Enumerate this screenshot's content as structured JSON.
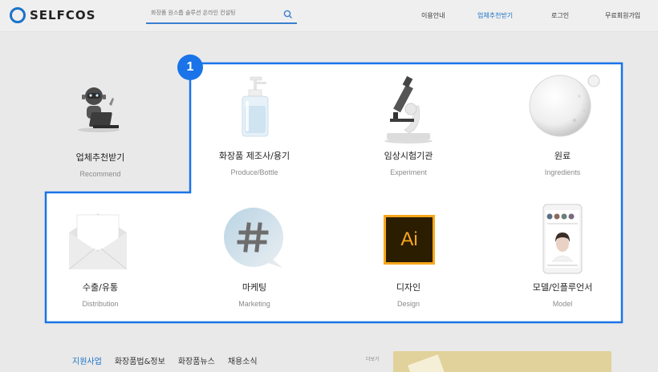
{
  "header": {
    "logo_text": "SELFCOS",
    "search_placeholder": "화장품 원스톱 솔루션 온라인 컨설팅",
    "nav": [
      {
        "label": "이용안내"
      },
      {
        "label": "업체추천받기"
      },
      {
        "label": "로그인"
      },
      {
        "label": "무료회원가입"
      }
    ]
  },
  "step_badge": "1",
  "cards": [
    {
      "title": "업체추천받기",
      "subtitle": "Recommend",
      "icon": "robot-laptop"
    },
    {
      "title": "화장품 제조사/용기",
      "subtitle": "Produce/Bottle",
      "icon": "pump-bottle"
    },
    {
      "title": "임상시험기관",
      "subtitle": "Experiment",
      "icon": "microscope"
    },
    {
      "title": "원료",
      "subtitle": "Ingredients",
      "icon": "gel-bubble"
    },
    {
      "title": "수출/유통",
      "subtitle": "Distribution",
      "icon": "envelope"
    },
    {
      "title": "마케팅",
      "subtitle": "Marketing",
      "icon": "hashtag"
    },
    {
      "title": "디자인",
      "subtitle": "Design",
      "icon": "illustrator"
    },
    {
      "title": "모델/인플루언서",
      "subtitle": "Model",
      "icon": "phone-model"
    }
  ],
  "illustrator_text": "Ai",
  "bottom": {
    "tabs": [
      {
        "label": "지원사업"
      },
      {
        "label": "화장품법&정보"
      },
      {
        "label": "화장품뉴스"
      },
      {
        "label": "채용소식"
      }
    ],
    "more_label": "더보기"
  },
  "colors": {
    "accent": "#1a73c9",
    "frame": "#1a73e8",
    "illustrator_bg": "#2b1d00",
    "illustrator_fg": "#f7a71c"
  }
}
